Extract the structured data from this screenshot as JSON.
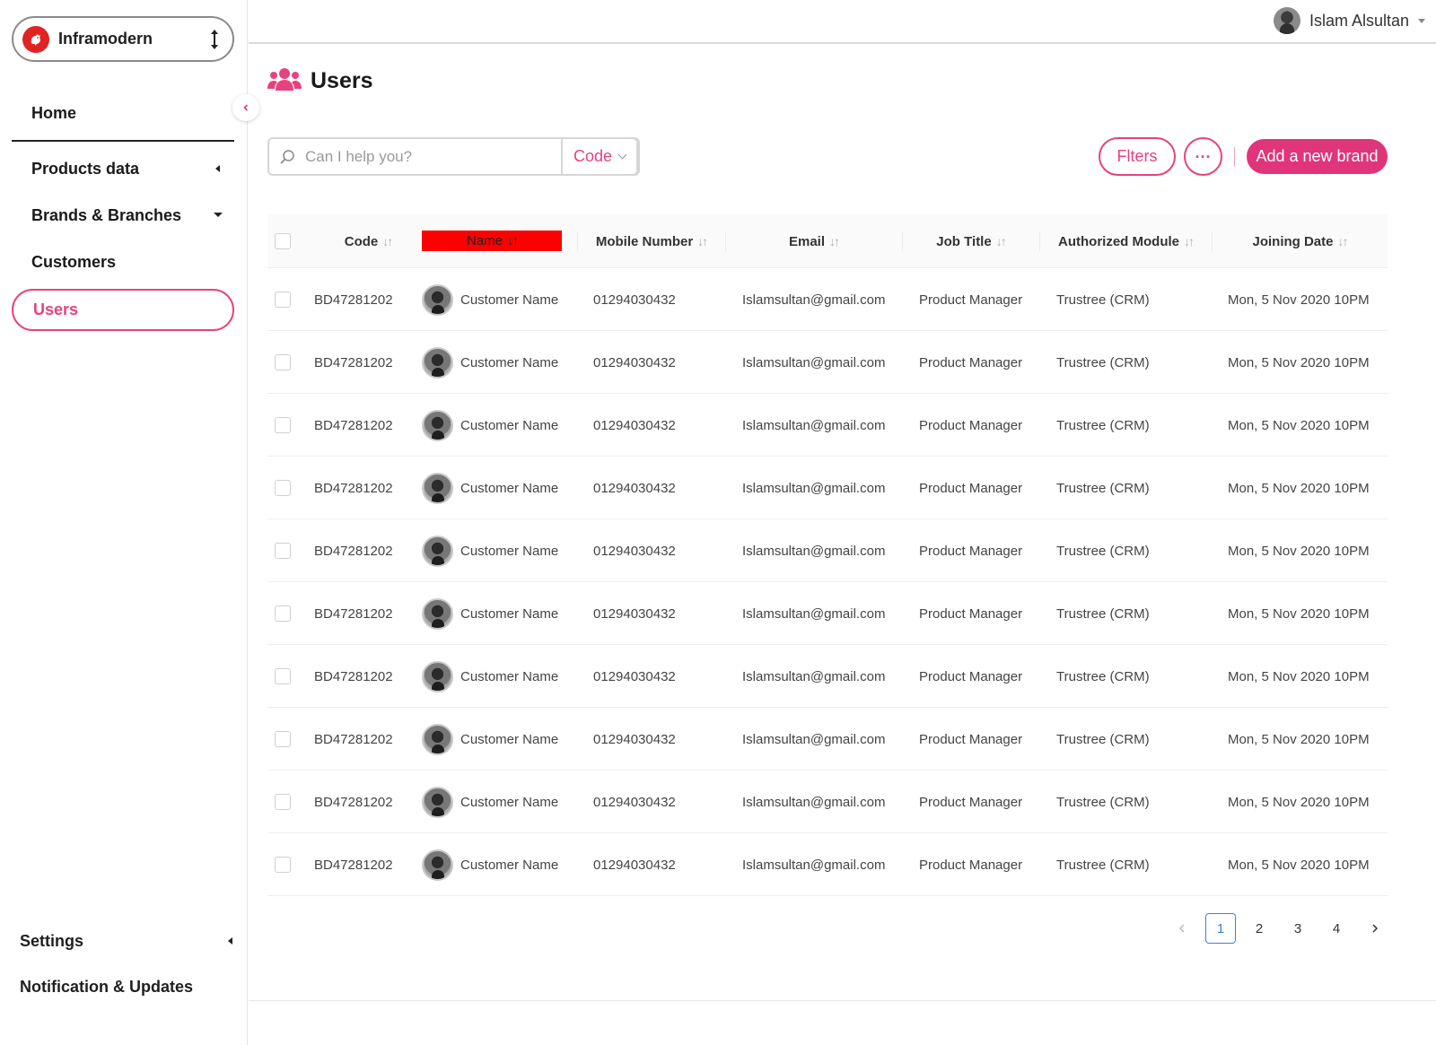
{
  "org": {
    "name": "Inframodern"
  },
  "sidebar": {
    "items": [
      {
        "label": "Home"
      },
      {
        "label": "Products data"
      },
      {
        "label": "Brands & Branches"
      },
      {
        "label": "Customers"
      },
      {
        "label": "Users"
      }
    ],
    "bottom_items": [
      {
        "label": "Settings"
      },
      {
        "label": "Notification & Updates"
      }
    ]
  },
  "topbar": {
    "user_name": "Islam Alsultan"
  },
  "page": {
    "title": "Users"
  },
  "toolbar": {
    "search_placeholder": "Can I help you?",
    "search_field": "Code",
    "filters_label": "Flters",
    "more_label": "···",
    "add_label": "Add a new brand"
  },
  "table": {
    "columns": [
      "Code",
      "Name",
      "Mobile Number",
      "Email",
      "Job Title",
      "Authorized Module",
      "Joining Date"
    ],
    "rows": [
      {
        "code": "BD47281202",
        "name": "Customer Name",
        "mobile": "01294030432",
        "email": "Islamsultan@gmail.com",
        "job": "Product Manager",
        "module": "Trustree (CRM)",
        "date": "Mon, 5 Nov 2020 10PM"
      },
      {
        "code": "BD47281202",
        "name": "Customer Name",
        "mobile": "01294030432",
        "email": "Islamsultan@gmail.com",
        "job": "Product Manager",
        "module": "Trustree (CRM)",
        "date": "Mon, 5 Nov 2020 10PM"
      },
      {
        "code": "BD47281202",
        "name": "Customer Name",
        "mobile": "01294030432",
        "email": "Islamsultan@gmail.com",
        "job": "Product Manager",
        "module": "Trustree (CRM)",
        "date": "Mon, 5 Nov 2020 10PM"
      },
      {
        "code": "BD47281202",
        "name": "Customer Name",
        "mobile": "01294030432",
        "email": "Islamsultan@gmail.com",
        "job": "Product Manager",
        "module": "Trustree (CRM)",
        "date": "Mon, 5 Nov 2020 10PM"
      },
      {
        "code": "BD47281202",
        "name": "Customer Name",
        "mobile": "01294030432",
        "email": "Islamsultan@gmail.com",
        "job": "Product Manager",
        "module": "Trustree (CRM)",
        "date": "Mon, 5 Nov 2020 10PM"
      },
      {
        "code": "BD47281202",
        "name": "Customer Name",
        "mobile": "01294030432",
        "email": "Islamsultan@gmail.com",
        "job": "Product Manager",
        "module": "Trustree (CRM)",
        "date": "Mon, 5 Nov 2020 10PM"
      },
      {
        "code": "BD47281202",
        "name": "Customer Name",
        "mobile": "01294030432",
        "email": "Islamsultan@gmail.com",
        "job": "Product Manager",
        "module": "Trustree (CRM)",
        "date": "Mon, 5 Nov 2020 10PM"
      },
      {
        "code": "BD47281202",
        "name": "Customer Name",
        "mobile": "01294030432",
        "email": "Islamsultan@gmail.com",
        "job": "Product Manager",
        "module": "Trustree (CRM)",
        "date": "Mon, 5 Nov 2020 10PM"
      },
      {
        "code": "BD47281202",
        "name": "Customer Name",
        "mobile": "01294030432",
        "email": "Islamsultan@gmail.com",
        "job": "Product Manager",
        "module": "Trustree (CRM)",
        "date": "Mon, 5 Nov 2020 10PM"
      },
      {
        "code": "BD47281202",
        "name": "Customer Name",
        "mobile": "01294030432",
        "email": "Islamsultan@gmail.com",
        "job": "Product Manager",
        "module": "Trustree (CRM)",
        "date": "Mon, 5 Nov 2020 10PM"
      }
    ]
  },
  "pagination": {
    "pages": [
      "1",
      "2",
      "3",
      "4"
    ],
    "current": "1"
  },
  "colors": {
    "accent": "#e6427f",
    "accent_solid": "#e0357a",
    "highlight": "#ff0000",
    "page_active": "#3b82d6"
  },
  "icons": {
    "org_logo": "rooster-logo-icon",
    "org_switch": "up-down-arrows-icon",
    "collapse": "chevron-left-icon",
    "page": "users-group-icon",
    "search": "search-icon",
    "sort": "sort-arrows-icon"
  }
}
